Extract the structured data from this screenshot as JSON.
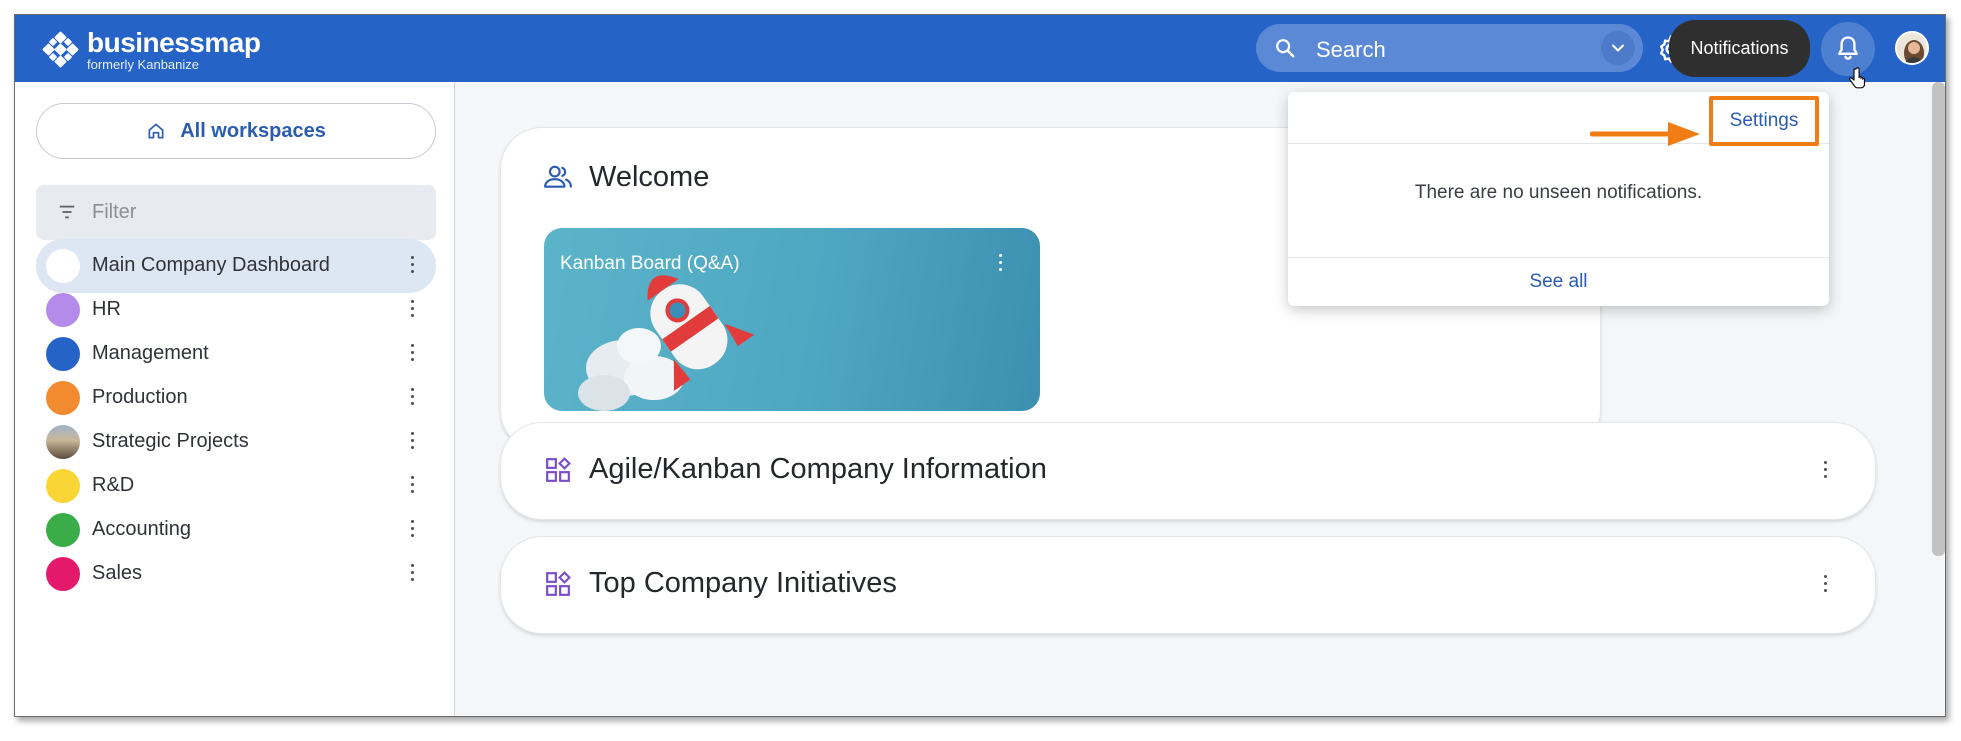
{
  "app": {
    "logo_name": "businessmap",
    "logo_sub": "formerly Kanbanize",
    "brand_color": "#2563c7"
  },
  "topbar": {
    "search_placeholder": "Search",
    "tooltip": "Notifications",
    "icons": [
      "search-icon",
      "chevron-down-icon",
      "gear-icon",
      "bell-icon",
      "avatar"
    ]
  },
  "sidebar": {
    "all_workspaces": "All workspaces",
    "filter_placeholder": "Filter",
    "items": [
      {
        "label": "Main Company Dashboard",
        "color": "#ffffff",
        "active": true
      },
      {
        "label": "HR",
        "color": "#b48be8"
      },
      {
        "label": "Management",
        "color": "#2563c7"
      },
      {
        "label": "Production",
        "color": "#f28a30"
      },
      {
        "label": "Strategic Projects",
        "color": "image"
      },
      {
        "label": "R&D",
        "color": "#f9d535"
      },
      {
        "label": "Accounting",
        "color": "#3aad48"
      },
      {
        "label": "Sales",
        "color": "#e5196b"
      }
    ]
  },
  "main": {
    "welcome_title": "Welcome",
    "board_title": "Kanban Board (Q&A)",
    "sections": [
      {
        "title": "Agile/Kanban Company Information"
      },
      {
        "title": "Top Company Initiatives"
      }
    ]
  },
  "notifications": {
    "settings": "Settings",
    "empty_text": "There are no unseen notifications.",
    "see_all": "See all",
    "highlight_color": "#f07d14"
  }
}
